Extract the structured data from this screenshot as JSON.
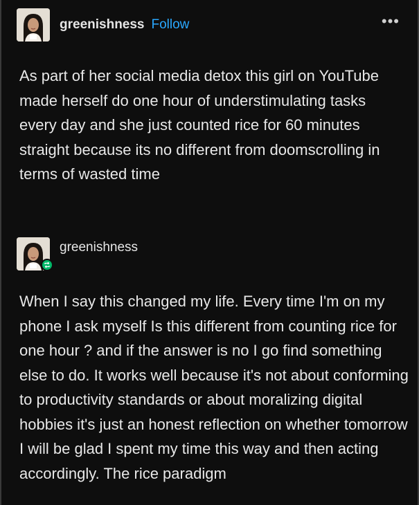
{
  "post": {
    "username": "greenishness",
    "follow_label": "Follow",
    "more_label": "•••",
    "body": "As part of her social media detox this girl on YouTube made herself do one hour of understimulating tasks every day and she just counted rice for 60 minutes straight because its no different from doomscrolling in terms of wasted time"
  },
  "reblog": {
    "username": "greenishness",
    "body": "When I say this changed my life. Every time I'm on my phone I ask myself Is this different from counting rice for one hour ? and if the answer is no I go find something else to do. It works well because it's not about conforming to productivity standards or about moralizing digital hobbies it's just an honest reflection on whether tomorrow I will be glad I spent my time this way and then acting accordingly. The rice paradigm"
  },
  "colors": {
    "background": "#0e0e0e",
    "text": "#e8e8e8",
    "follow_accent": "#2aa8ff",
    "reblog_badge": "#00b868"
  }
}
